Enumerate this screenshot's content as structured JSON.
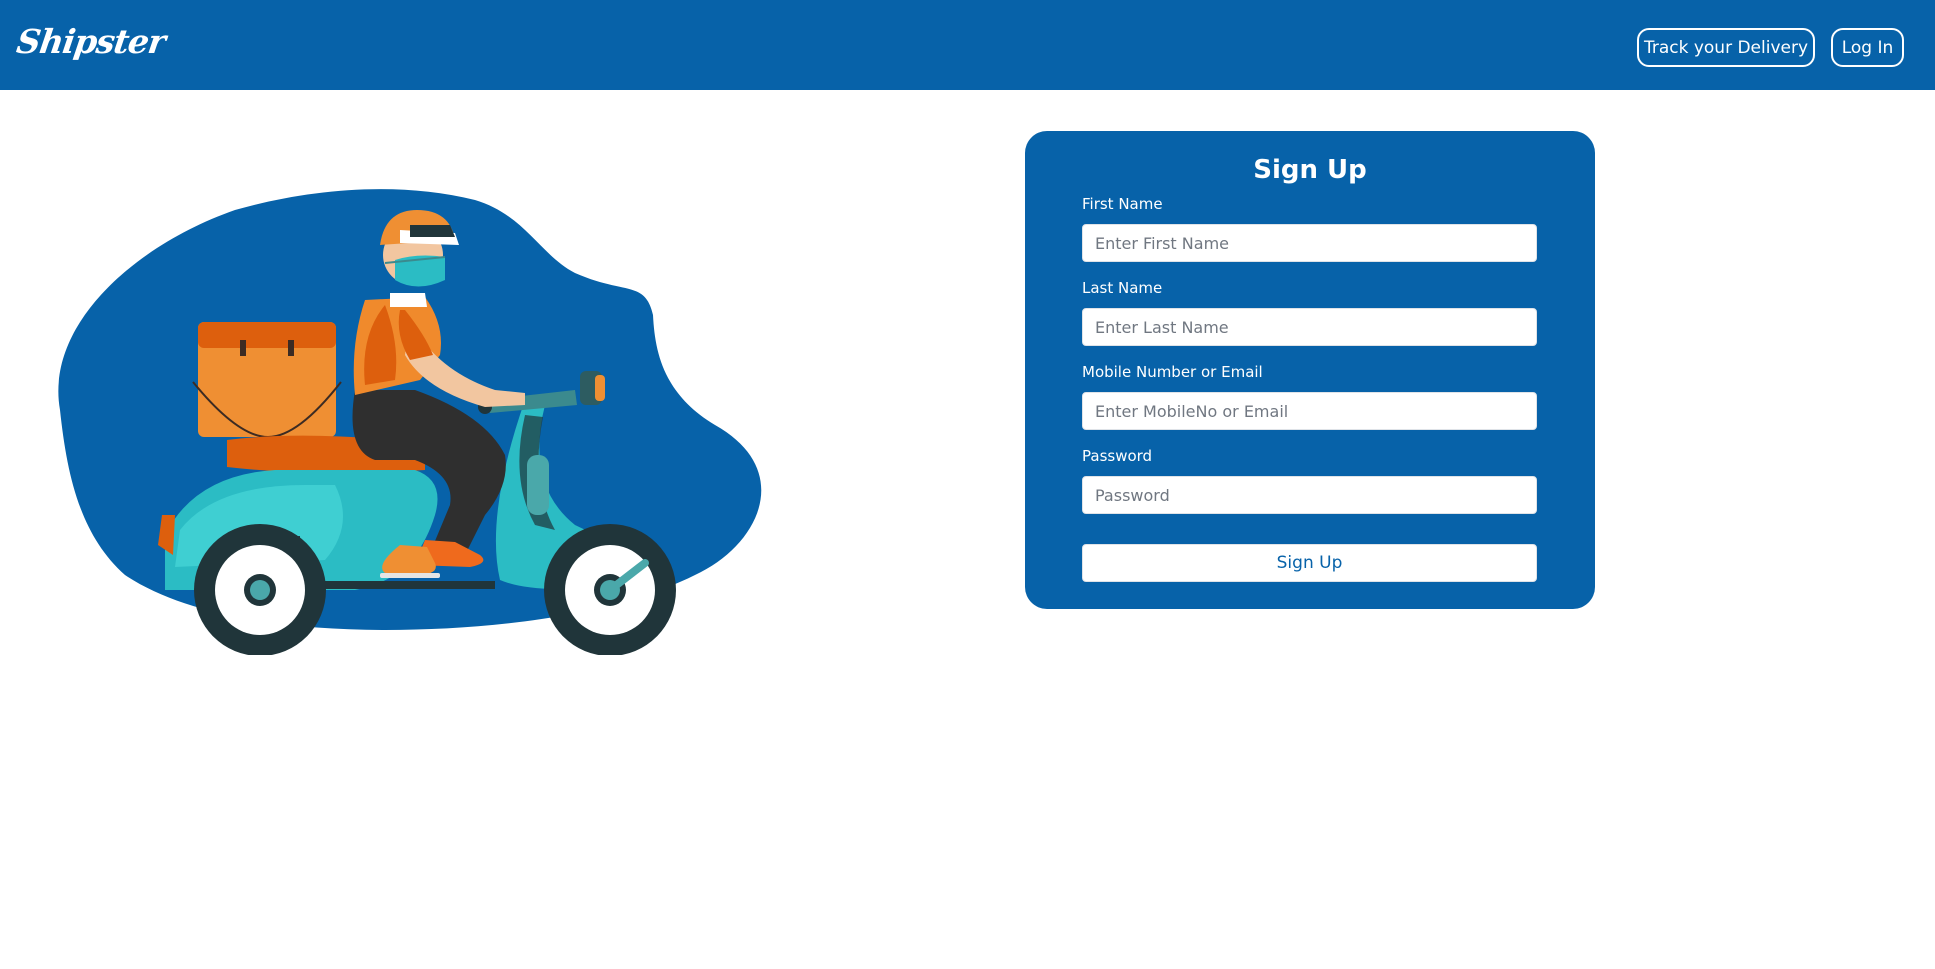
{
  "header": {
    "logo_text": "Shipster",
    "track_label": "Track your Delivery",
    "login_label": "Log In"
  },
  "form": {
    "title": "Sign Up",
    "first_name": {
      "label": "First Name",
      "placeholder": "Enter First Name",
      "value": ""
    },
    "last_name": {
      "label": "Last Name",
      "placeholder": "Enter Last Name",
      "value": ""
    },
    "contact": {
      "label": "Mobile Number or Email",
      "placeholder": "Enter MobileNo or Email",
      "value": ""
    },
    "password": {
      "label": "Password",
      "placeholder": "Password",
      "value": ""
    },
    "submit_label": "Sign Up"
  },
  "colors": {
    "brand_blue": "#0762a9",
    "scooter_teal": "#2bbcc4",
    "rider_orange": "#f08a2c",
    "box_orange": "#ef8f33",
    "tire_dark": "#20353a"
  },
  "illustration": {
    "icon": "delivery-scooter-rider-icon"
  }
}
